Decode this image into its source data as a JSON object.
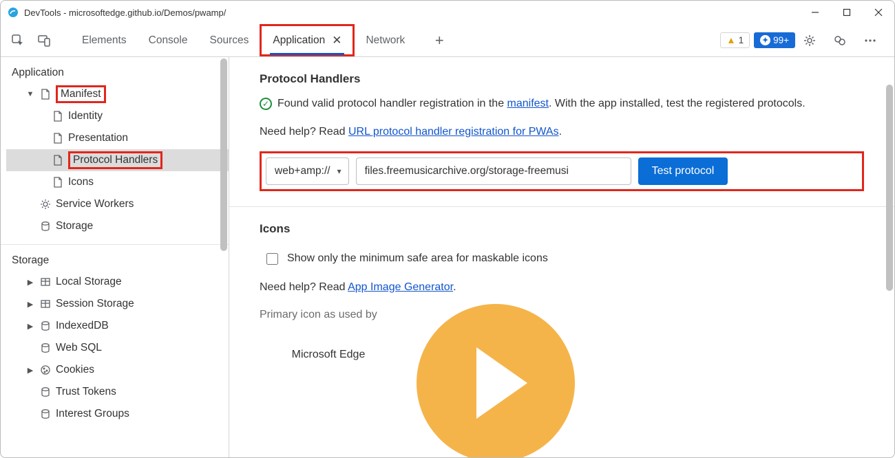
{
  "window": {
    "title": "DevTools - microsoftedge.github.io/Demos/pwamp/"
  },
  "tabs": {
    "items": [
      "Elements",
      "Console",
      "Sources",
      "Application",
      "Network"
    ],
    "active": "Application",
    "warn_count": "1",
    "info_count": "99+"
  },
  "sidebar": {
    "section_app": "Application",
    "manifest": "Manifest",
    "manifest_children": [
      "Identity",
      "Presentation",
      "Protocol Handlers",
      "Icons"
    ],
    "service_workers": "Service Workers",
    "storage_app": "Storage",
    "section_storage": "Storage",
    "storage_items": [
      "Local Storage",
      "Session Storage",
      "IndexedDB",
      "Web SQL",
      "Cookies",
      "Trust Tokens",
      "Interest Groups"
    ]
  },
  "content": {
    "ph_heading": "Protocol Handlers",
    "valid_pre": "Found valid protocol handler registration in the ",
    "manifest_link": "manifest",
    "valid_post": ". With the app installed, test the registered protocols.",
    "help_pre": "Need help? Read ",
    "help_link": "URL protocol handler registration for PWAs",
    "help_post": ".",
    "proto_scheme": "web+amp://",
    "proto_url": "files.freemusicarchive.org/storage-freemusi",
    "test_btn": "Test protocol",
    "icons_heading": "Icons",
    "icons_checkbox": "Show only the minimum safe area for maskable icons",
    "icons_help_pre": "Need help? Read ",
    "icons_help_link": "App Image Generator",
    "icons_help_post": ".",
    "primary_icon_label": "Primary icon as used by",
    "primary_icon_sub": "Microsoft Edge"
  }
}
